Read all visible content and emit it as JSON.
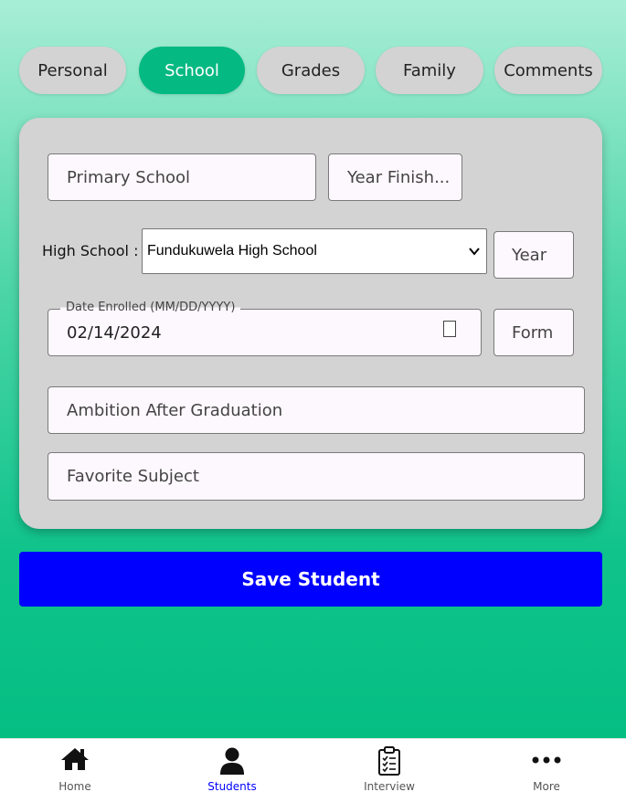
{
  "tabs": [
    {
      "label": "Personal",
      "active": false
    },
    {
      "label": "School",
      "active": true
    },
    {
      "label": "Grades",
      "active": false
    },
    {
      "label": "Family",
      "active": false
    },
    {
      "label": "Comments",
      "active": false
    }
  ],
  "form": {
    "primary_school_placeholder": "Primary School",
    "year_finished_placeholder": "Year Finish...",
    "high_school_label": "High School :",
    "high_school_selected": "Fundukuwela High School",
    "year_placeholder": "Year",
    "date_enrolled_label": "Date Enrolled (MM/DD/YYYY)",
    "date_enrolled_value": "02/14/2024",
    "form_placeholder": "Form",
    "ambition_placeholder": "Ambition After Graduation",
    "favorite_subject_placeholder": "Favorite Subject"
  },
  "save_button": "Save Student",
  "nav": [
    {
      "label": "Home",
      "icon": "home-icon",
      "active": false
    },
    {
      "label": "Students",
      "icon": "person-icon",
      "active": true
    },
    {
      "label": "Interview",
      "icon": "clipboard-icon",
      "active": false
    },
    {
      "label": "More",
      "icon": "more-icon",
      "active": false
    }
  ],
  "colors": {
    "active_tab": "#04b982",
    "save_button": "#0000ff",
    "active_nav": "#0000ff",
    "card": "#d3d3d3"
  }
}
